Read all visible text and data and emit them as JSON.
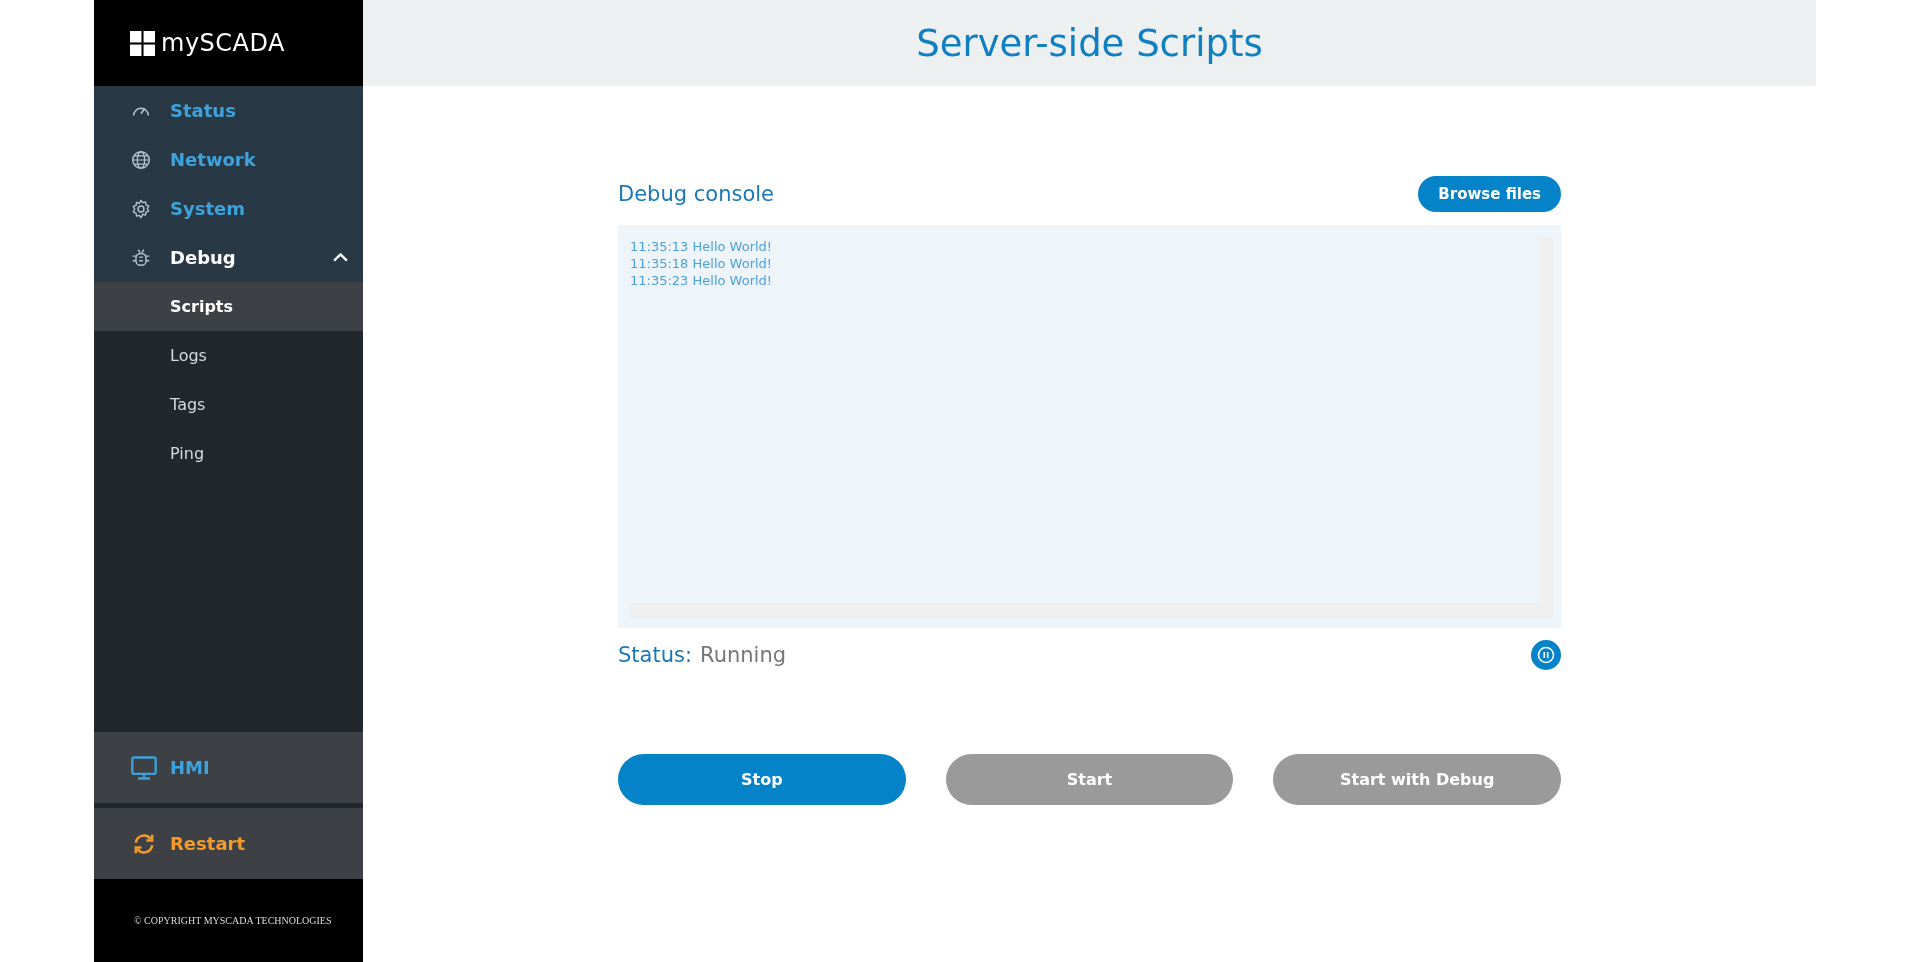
{
  "sidebar": {
    "logo": "mySCADA",
    "items": [
      {
        "label": "Status",
        "selected": false
      },
      {
        "label": "Network",
        "selected": false
      },
      {
        "label": "System",
        "selected": false
      },
      {
        "label": "Debug",
        "selected": true,
        "expanded": true,
        "children": [
          {
            "label": "Scripts",
            "selected": true
          },
          {
            "label": "Logs",
            "selected": false
          },
          {
            "label": "Tags",
            "selected": false
          },
          {
            "label": "Ping",
            "selected": false
          }
        ]
      }
    ],
    "bottom_items": [
      {
        "label": "HMI",
        "color": "#3ea3dc"
      },
      {
        "label": "Restart",
        "color": "#f39a2b"
      }
    ],
    "copyright": "© COPYRIGHT MYSCADA TECHNOLOGIES"
  },
  "header": {
    "title": "Server-side Scripts"
  },
  "console": {
    "title": "Debug console",
    "browse_button": "Browse files",
    "lines": [
      "11:35:13 Hello World!",
      "11:35:18 Hello World!",
      "11:35:23 Hello World!"
    ]
  },
  "status": {
    "label": "Status:",
    "value": "Running"
  },
  "buttons": [
    {
      "label": "Stop",
      "disabled": false
    },
    {
      "label": "Start",
      "disabled": true
    },
    {
      "label": "Start with Debug",
      "disabled": true
    }
  ]
}
